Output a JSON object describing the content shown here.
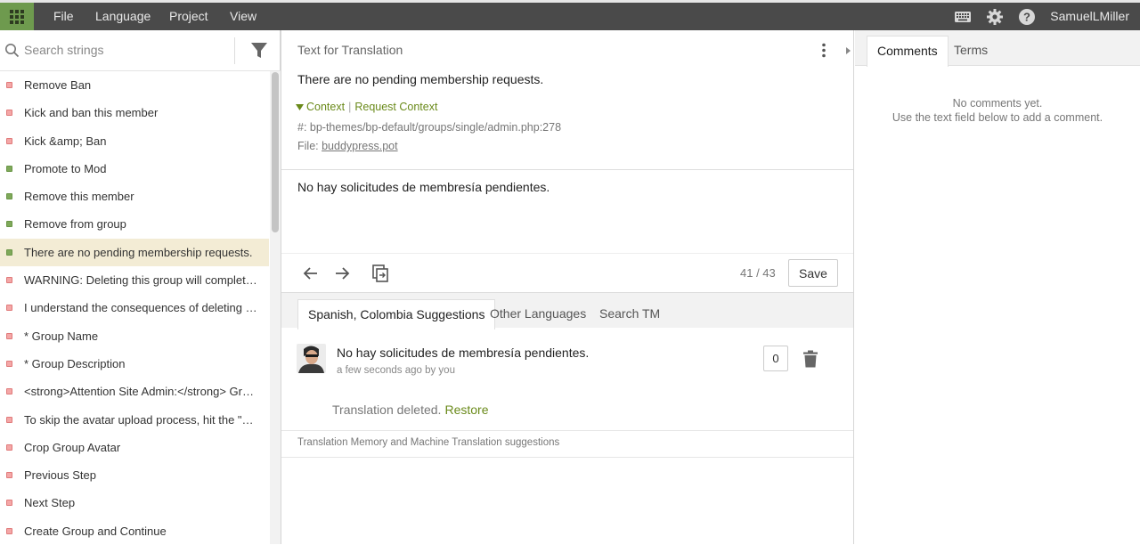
{
  "topbar": {
    "menu": [
      "File",
      "Language",
      "Project",
      "View"
    ],
    "user": "SamuelLMiller",
    "accent": "#6e9a4e"
  },
  "left": {
    "search_placeholder": "Search strings",
    "strings": [
      {
        "text": "Remove Ban",
        "status": "red"
      },
      {
        "text": "Kick and ban this member",
        "status": "red"
      },
      {
        "text": "Kick &amp; Ban",
        "status": "red"
      },
      {
        "text": "Promote to Mod",
        "status": "green"
      },
      {
        "text": "Remove this member",
        "status": "green"
      },
      {
        "text": "Remove from group",
        "status": "green"
      },
      {
        "text": "There are no pending membership requests.",
        "status": "green"
      },
      {
        "text": "WARNING: Deleting this group will completely remove ALL content associated with it.",
        "status": "red"
      },
      {
        "text": "I understand the consequences of deleting this group.",
        "status": "red"
      },
      {
        "text": "* Group Name",
        "status": "red"
      },
      {
        "text": "* Group Description",
        "status": "red"
      },
      {
        "text": "<strong>Attention Site Admin:</strong> Group forums require the bbPress plugin.",
        "status": "red"
      },
      {
        "text": "To skip the avatar upload process, hit the \"Next Step\" button.",
        "status": "red"
      },
      {
        "text": "Crop Group Avatar",
        "status": "red"
      },
      {
        "text": "Previous Step",
        "status": "red"
      },
      {
        "text": "Next Step",
        "status": "red"
      },
      {
        "text": "Create Group and Continue",
        "status": "red"
      }
    ],
    "selected_index": 6
  },
  "center": {
    "header_label": "Text for Translation",
    "source_text": "There are no pending membership requests.",
    "context_label": "Context",
    "request_context_label": "Request Context",
    "reference": "#: bp-themes/bp-default/groups/single/admin.php:278",
    "file_label": "File:",
    "file_name": "buddypress.pot",
    "translation": "No hay solicitudes de membresía pendientes.",
    "counter": "41 / 43",
    "save_label": "Save",
    "tabs": [
      "Spanish, Colombia Suggestions",
      "Other Languages",
      "Search TM"
    ],
    "suggestion": {
      "text": "No hay solicitudes de membresía pendientes.",
      "meta": "a few seconds ago by you",
      "votes": "0"
    },
    "deleted_text": "Translation deleted.",
    "restore_label": "Restore",
    "tm_note": "Translation Memory and Machine Translation suggestions"
  },
  "right": {
    "tabs": [
      "Comments",
      "Terms"
    ],
    "no_comments": "No comments yet.",
    "hint": "Use the text field below to add a comment."
  },
  "colors": {
    "link_green": "#6a8a1a",
    "selected_row": "#f3ecd5",
    "status_red": "#f4a7a7",
    "status_green": "#7fa95a"
  },
  "icons": [
    "apps-grid-icon",
    "keyboard-icon",
    "gear-icon",
    "help-icon",
    "search-icon",
    "filter-icon",
    "more-vertical-icon",
    "arrow-left-icon",
    "arrow-right-icon",
    "copy-source-icon",
    "trash-icon",
    "avatar"
  ]
}
